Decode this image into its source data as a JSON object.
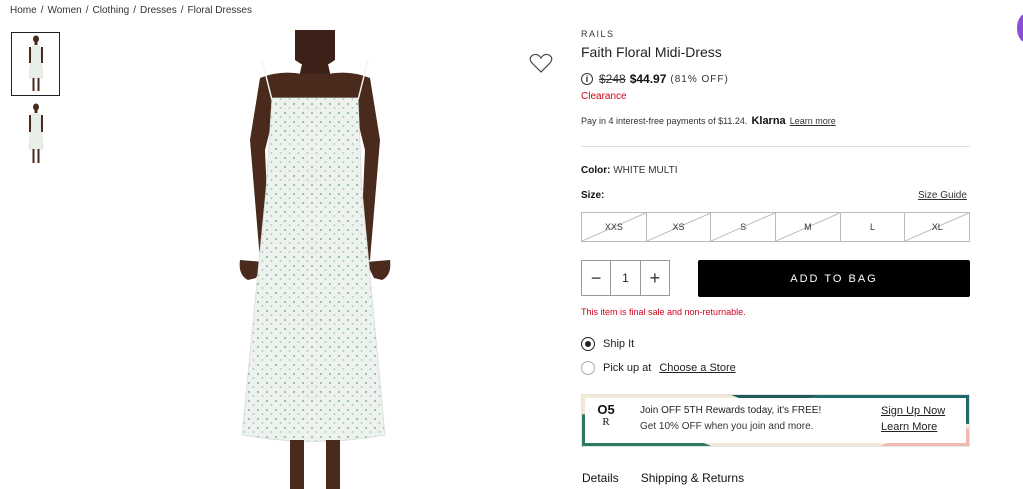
{
  "breadcrumb": [
    "Home",
    "Women",
    "Clothing",
    "Dresses",
    "Floral Dresses"
  ],
  "breadcrumb_sep": "/",
  "product": {
    "brand": "RAILS",
    "title": "Faith Floral Midi-Dress",
    "info_icon": "info-icon",
    "price_original": "$248",
    "price_sale": "$44.97",
    "discount": "(81% OFF)",
    "status": "Clearance"
  },
  "klarna": {
    "text": "Pay in 4 interest-free payments of $11.24.",
    "brand": "Klarna",
    "link": "Learn more"
  },
  "color": {
    "label": "Color:",
    "value": "WHITE MULTI"
  },
  "size": {
    "label": "Size:",
    "guide": "Size Guide",
    "options": [
      "XXS",
      "XS",
      "S",
      "M",
      "L",
      "XL"
    ],
    "unavailable": [
      "XXS",
      "XS",
      "S",
      "M",
      "XL"
    ]
  },
  "quantity": {
    "minus": "−",
    "value": "1",
    "plus": "+"
  },
  "add_to_bag": "ADD TO BAG",
  "final_sale": "This item is final sale and non-returnable.",
  "fulfillment": {
    "ship": "Ship It",
    "pickup_prefix": "Pick up at",
    "pickup_link": "Choose a Store",
    "selected": "ship"
  },
  "rewards": {
    "logo_top": "O5",
    "logo_bottom": "R",
    "line1": "Join OFF 5TH Rewards today, it's FREE!",
    "line2": "Get 10% OFF when you join and more.",
    "signup": "Sign Up Now",
    "learn": "Learn More"
  },
  "tabs": [
    "Details",
    "Shipping & Returns"
  ],
  "colors": {
    "accent_red": "#d0021b",
    "button_black": "#000000",
    "dress": "#e8efe9",
    "skin": "#4a2a1c"
  }
}
